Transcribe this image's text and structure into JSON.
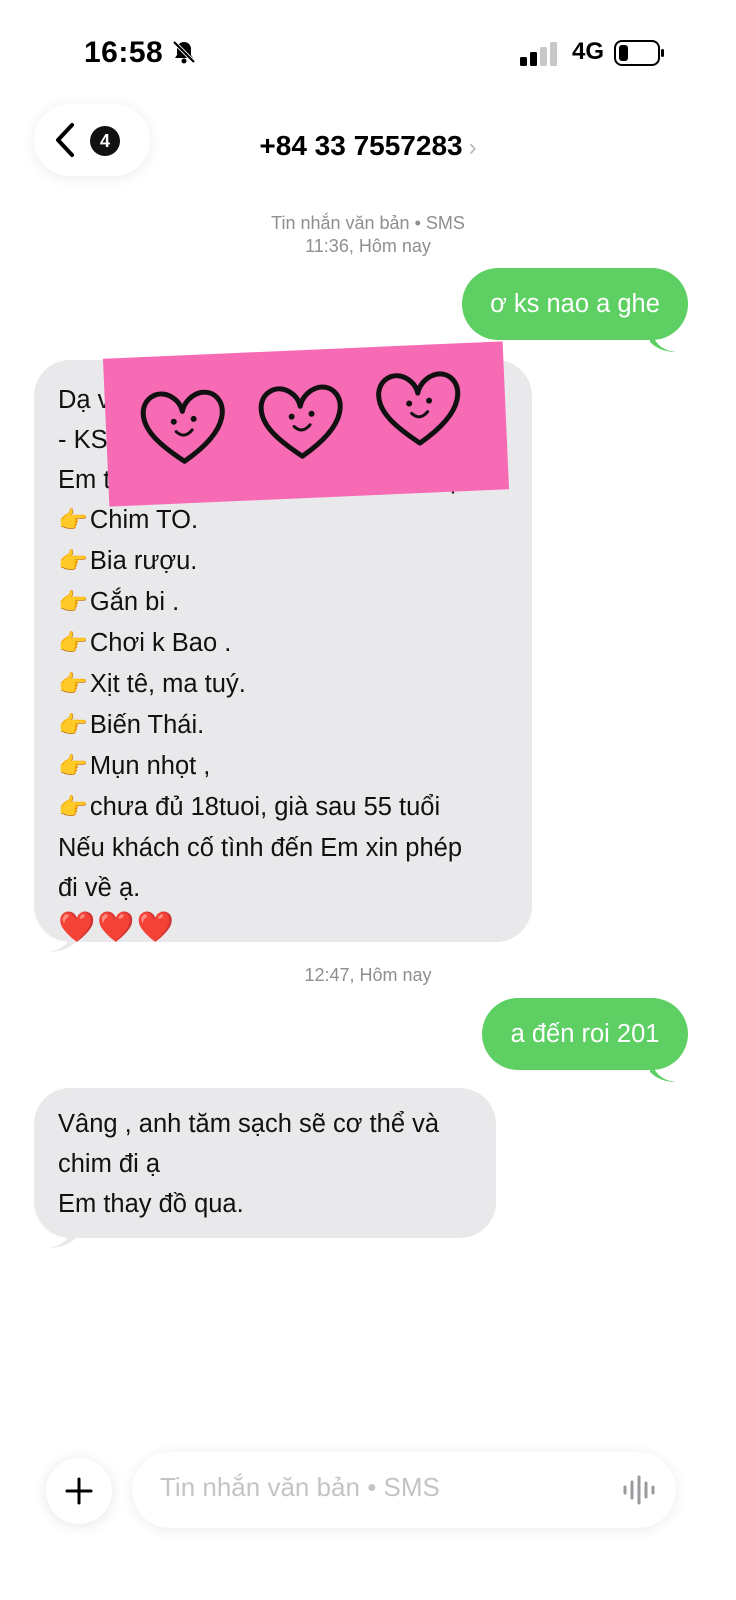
{
  "status": {
    "time": "16:58",
    "network": "4G"
  },
  "nav": {
    "unread_count": "4",
    "contact": "+84 33 7557283",
    "chevron": "›"
  },
  "thread": {
    "header1_line1": "Tin nhắn văn bản • SMS",
    "header1_line2": "11:36, Hôm nay",
    "msg1": "ơ ks nao a ghe",
    "msg2_lines": [
      "Dạ v",
      "- KS",
      "Em t",
      "Chim TO.",
      "Bia rượu.",
      "Gắn bi .",
      "Chơi k Bao .",
      "Xịt tê, ma tuý.",
      "Biến Thái.",
      "Mụn nhọt ,",
      "chưa đủ 18tuoi, già sau 55 tuổi",
      "Nếu khách cố tình đến Em xin phép",
      "đi về ạ.",
      "❤️❤️❤️"
    ],
    "msg2_partial_end": "g hợp.",
    "pointer_emoji": "👉",
    "header2": "12:47, Hôm nay",
    "msg3": "a đến roi 201",
    "msg4_lines": [
      "Vâng , anh tăm sạch sẽ cơ thể và",
      "chim đi ạ",
      "Em thay đồ qua."
    ]
  },
  "compose": {
    "placeholder": "Tin nhắn văn bản • SMS"
  },
  "colors": {
    "outgoing": "#5ecf63",
    "incoming": "#e9e9eb",
    "sticker": "#f76bb5"
  }
}
